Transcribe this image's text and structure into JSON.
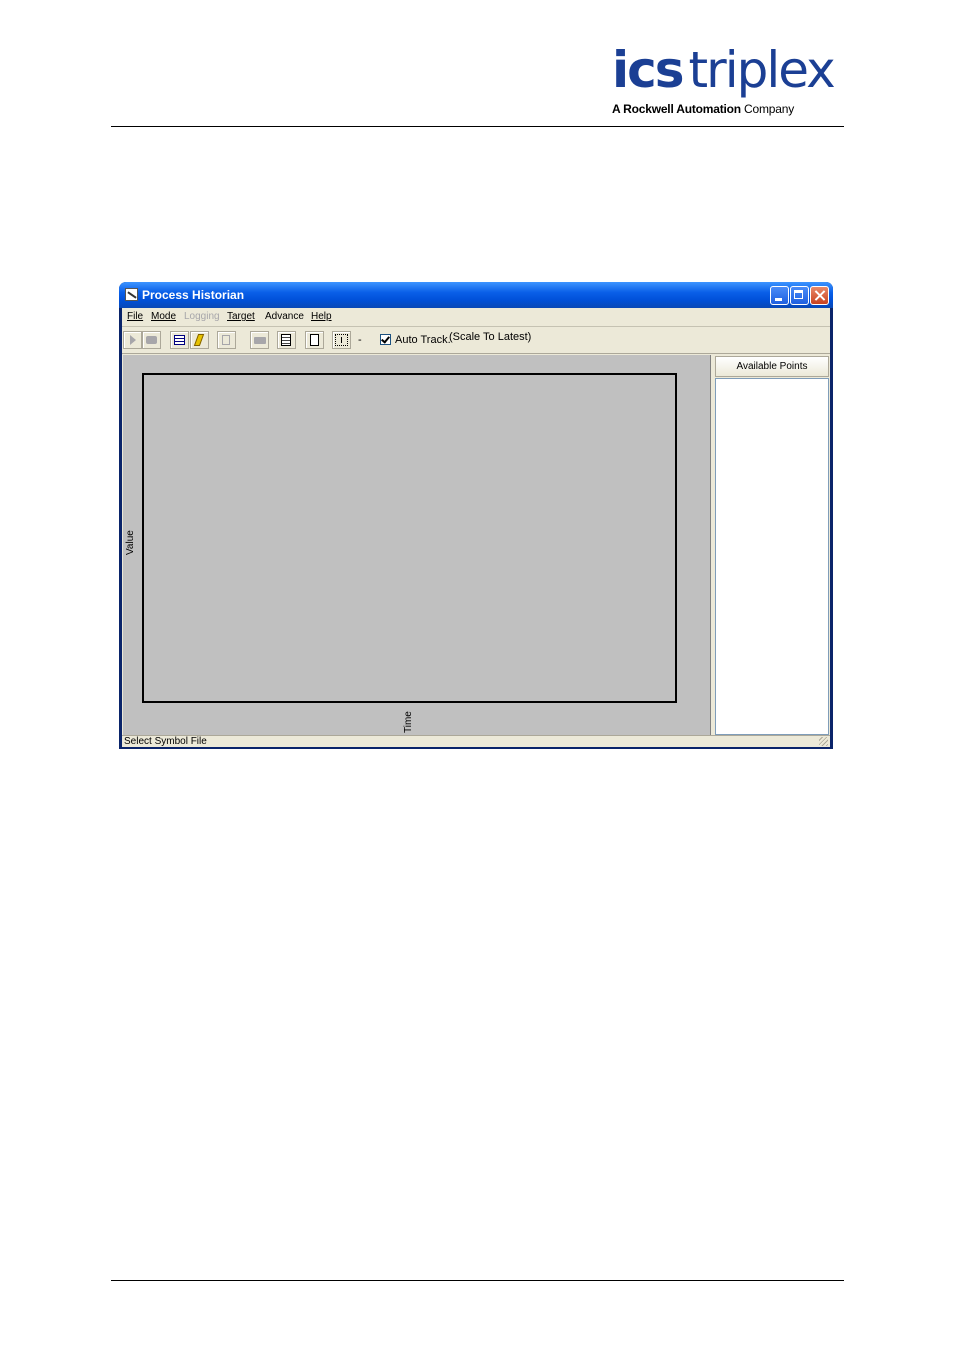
{
  "brand": {
    "logo_main_1": "ics",
    "logo_main_2": "triplex",
    "logo_sub_1": "A ",
    "logo_sub_bold": "Rockwell Automation",
    "logo_sub_2": " Company",
    "color": "#1b3f94"
  },
  "window": {
    "title": "Process Historian",
    "controls": [
      "minimize-icon",
      "maximize-icon",
      "close-icon"
    ]
  },
  "menu": {
    "file": "File",
    "mode": "Mode",
    "logging": "Logging",
    "target": "Target",
    "advance": "Advance",
    "help": "Help"
  },
  "toolbar": {
    "minus_label": "-",
    "auto_track_label": "Auto Track.",
    "auto_track_checked": true,
    "scale_label": "(Scale To Latest)"
  },
  "chart": {
    "y_axis_label": "Value",
    "x_axis_label": "Time"
  },
  "points": {
    "header": "Available Points"
  },
  "status": {
    "text": "Select Symbol File"
  }
}
